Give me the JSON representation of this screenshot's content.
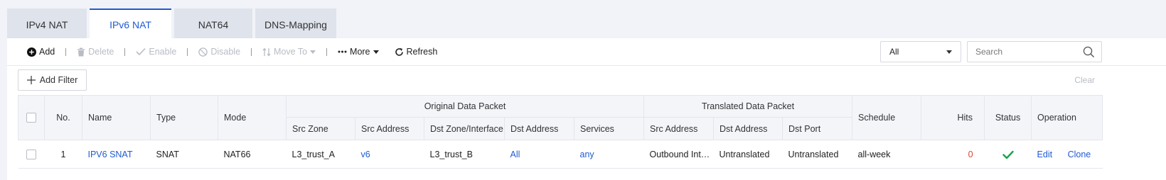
{
  "tabs": [
    {
      "label": "IPv4 NAT",
      "active": false
    },
    {
      "label": "IPv6 NAT",
      "active": true
    },
    {
      "label": "NAT64",
      "active": false
    },
    {
      "label": "DNS-Mapping",
      "active": false
    }
  ],
  "toolbar": {
    "add": "Add",
    "delete": "Delete",
    "enable": "Enable",
    "disable": "Disable",
    "move_to": "Move To",
    "more": "More",
    "refresh": "Refresh"
  },
  "filter_select": {
    "value": "All"
  },
  "search": {
    "placeholder": "Search"
  },
  "add_filter": "Add Filter",
  "clear": "Clear",
  "table": {
    "headers": {
      "no": "No.",
      "name": "Name",
      "type": "Type",
      "mode": "Mode",
      "original_group": "Original Data Packet",
      "translated_group": "Translated Data Packet",
      "schedule": "Schedule",
      "hits": "Hits",
      "status": "Status",
      "operation": "Operation",
      "src_zone": "Src Zone",
      "src_address": "Src Address",
      "dst_zone_interface": "Dst Zone/Interface",
      "dst_address": "Dst Address",
      "services": "Services",
      "t_src_address": "Src Address",
      "t_dst_address": "Dst Address",
      "t_dst_port": "Dst Port"
    },
    "rows": [
      {
        "no": "1",
        "name": "IPV6 SNAT",
        "type": "SNAT",
        "mode": "NAT66",
        "src_zone": "L3_trust_A",
        "src_address": "v6",
        "dst_zone_interface": "L3_trust_B",
        "dst_address": "All",
        "services": "any",
        "t_src_address": "Outbound Int…",
        "t_dst_address": "Untranslated",
        "t_dst_port": "Untranslated",
        "schedule": "all-week",
        "hits": "0",
        "status": "enabled",
        "edit": "Edit",
        "clone": "Clone"
      }
    ]
  },
  "colors": {
    "accent": "#1f5bd2",
    "status_ok": "#1aa34a",
    "hits": "#e0422f"
  }
}
